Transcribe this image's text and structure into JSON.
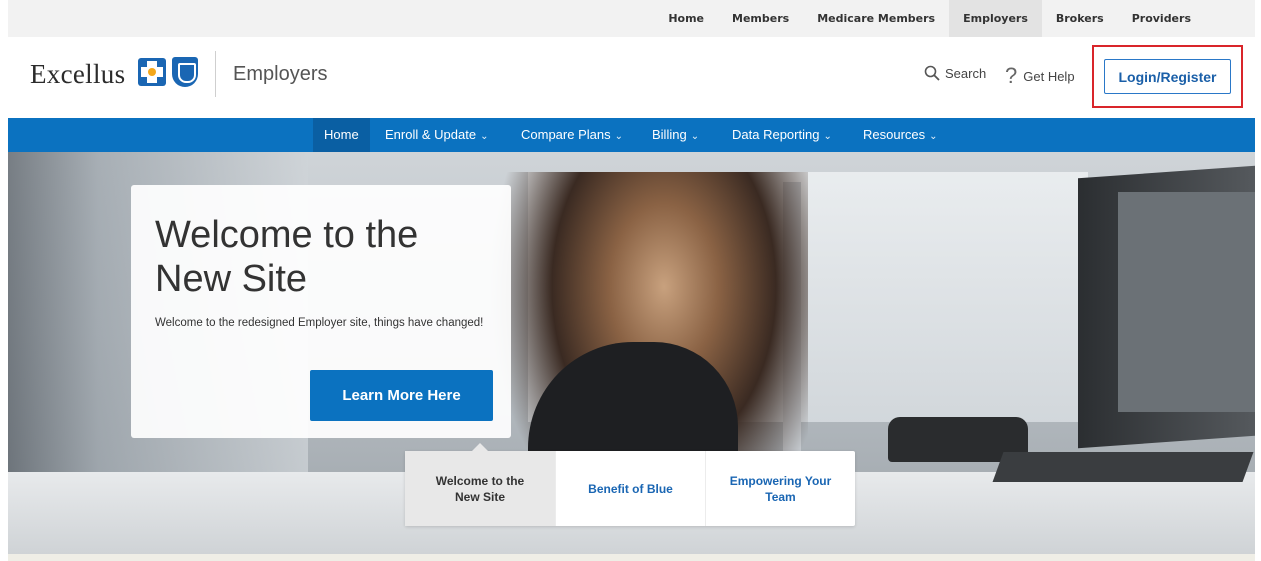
{
  "top_nav": {
    "items": [
      {
        "label": "Home",
        "active": false
      },
      {
        "label": "Members",
        "active": false
      },
      {
        "label": "Medicare Members",
        "active": false
      },
      {
        "label": "Employers",
        "active": true
      },
      {
        "label": "Brokers",
        "active": false
      },
      {
        "label": "Providers",
        "active": false
      }
    ]
  },
  "header": {
    "logo_text": "Excellus",
    "logo_icons": [
      "blue-cross-icon",
      "blue-shield-icon"
    ],
    "section_title": "Employers",
    "search_label": "Search",
    "help_label": "Get Help",
    "help_icon": "?",
    "login_label": "Login/Register"
  },
  "main_nav": {
    "items": [
      {
        "label": "Home",
        "active": true,
        "dropdown": false
      },
      {
        "label": "Enroll & Update",
        "active": false,
        "dropdown": true
      },
      {
        "label": "Compare Plans",
        "active": false,
        "dropdown": true
      },
      {
        "label": "Billing",
        "active": false,
        "dropdown": true
      },
      {
        "label": "Data Reporting",
        "active": false,
        "dropdown": true
      },
      {
        "label": "Resources",
        "active": false,
        "dropdown": true
      }
    ],
    "chevron": "⌄"
  },
  "hero": {
    "title": "Welcome to the New Site",
    "text": "Welcome to the redesigned Employer site, things have changed!",
    "cta_label": "Learn More Here"
  },
  "hero_tabs": [
    {
      "label": "Welcome to the New Site",
      "active": true
    },
    {
      "label": "Benefit of Blue",
      "active": false
    },
    {
      "label": "Empowering Your Team",
      "active": false
    }
  ],
  "colors": {
    "brand_blue": "#0b72c0",
    "highlight_red": "#d9252a",
    "link_blue": "#1a66b3"
  }
}
